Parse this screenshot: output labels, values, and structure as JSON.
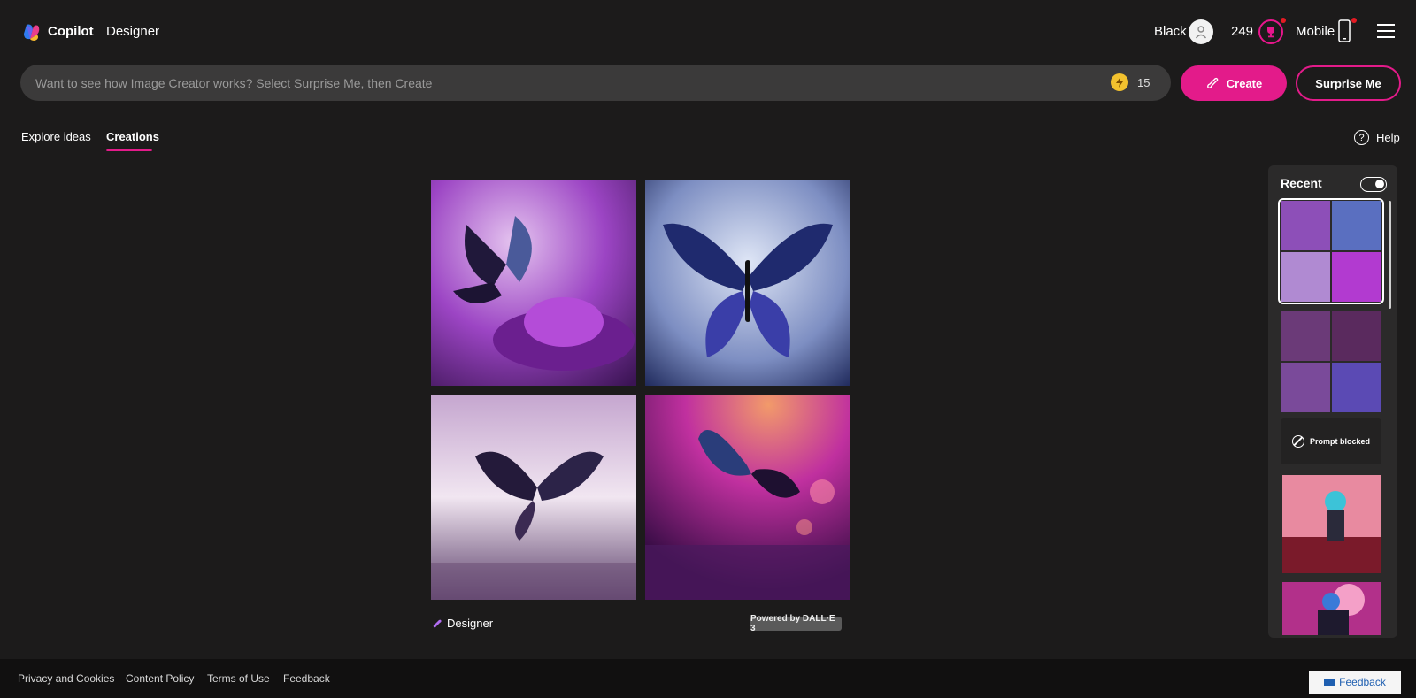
{
  "header": {
    "brand": "Copilot",
    "product": "Designer",
    "user_name": "Black",
    "points": "249",
    "mobile_label": "Mobile"
  },
  "search": {
    "placeholder": "Want to see how Image Creator works? Select Surprise Me, then Create",
    "boost_count": "15"
  },
  "actions": {
    "create_label": "Create",
    "surprise_label": "Surprise Me"
  },
  "tabs": [
    {
      "label": "Explore ideas",
      "active": false
    },
    {
      "label": "Creations",
      "active": true
    }
  ],
  "help_label": "Help",
  "help_icon_glyph": "?",
  "gallery": {
    "images": [
      {
        "name": "butterfly-purple-flower-image",
        "palette": [
          "#e4c3ef",
          "#9c45c4",
          "#3b1454"
        ]
      },
      {
        "name": "butterfly-blue-wings-image",
        "palette": [
          "#dfe6f6",
          "#7d8ec2",
          "#1a2456"
        ]
      },
      {
        "name": "butterfly-meadow-image",
        "palette": [
          "#f1e6f1",
          "#c5a6cf",
          "#5b3f6a"
        ]
      },
      {
        "name": "butterfly-pink-bokeh-image",
        "palette": [
          "#f29a6a",
          "#c0309f",
          "#3a0d47"
        ]
      }
    ],
    "footer_brand": "Designer",
    "powered_by": "Powered by DALL·E 3"
  },
  "recent": {
    "title": "Recent",
    "toggle_on": true,
    "sets": [
      {
        "colors": [
          "#8d4fb8",
          "#5a6fc0",
          "#b08ad2",
          "#b23ad0"
        ],
        "selected": true
      },
      {
        "colors": [
          "#6b3a78",
          "#5a2a5e",
          "#7a4a9a",
          "#5b4ab4"
        ],
        "selected": false
      }
    ],
    "blocked_label": "Prompt blocked"
  },
  "footer": {
    "links": [
      "Privacy and Cookies",
      "Content Policy",
      "Terms of Use",
      "Feedback"
    ],
    "feedback_button": "Feedback"
  },
  "colors": {
    "accent": "#e31b8a",
    "background": "#1c1b1b",
    "search_bg": "#3b3a3a",
    "boost": "#f2c12e"
  }
}
